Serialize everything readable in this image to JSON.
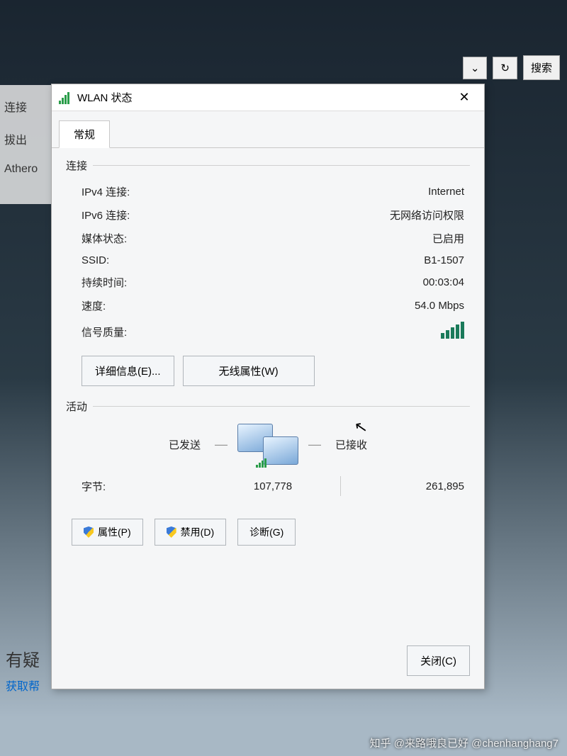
{
  "toolbar": {
    "dropdown_arrow": "⌄",
    "refresh_arrow": "↻",
    "search_placeholder": "搜索"
  },
  "background": {
    "sidebar_header": "连接",
    "sidebar_sub1": "拔出",
    "sidebar_sub2": "Athero",
    "bottom_text": "有疑",
    "bottom_link": "获取帮"
  },
  "dialog": {
    "title": "WLAN 状态",
    "tab_general": "常规",
    "section_connection": "连接",
    "rows": {
      "ipv4_label": "IPv4 连接:",
      "ipv4_value": "Internet",
      "ipv6_label": "IPv6 连接:",
      "ipv6_value": "无网络访问权限",
      "media_label": "媒体状态:",
      "media_value": "已启用",
      "ssid_label": "SSID:",
      "ssid_value": "B1-1507",
      "duration_label": "持续时间:",
      "duration_value": "00:03:04",
      "speed_label": "速度:",
      "speed_value": "54.0 Mbps",
      "signal_label": "信号质量:"
    },
    "details_btn": "详细信息(E)...",
    "wireless_btn": "无线属性(W)",
    "section_activity": "活动",
    "sent_label": "已发送",
    "received_label": "已接收",
    "bytes_label": "字节:",
    "bytes_sent": "107,778",
    "bytes_received": "261,895",
    "properties_btn": "属性(P)",
    "disable_btn": "禁用(D)",
    "diagnose_btn": "诊断(G)",
    "close_btn": "关闭(C)"
  },
  "watermark": "知乎 @来路哦良已好 @chenhanghang7"
}
